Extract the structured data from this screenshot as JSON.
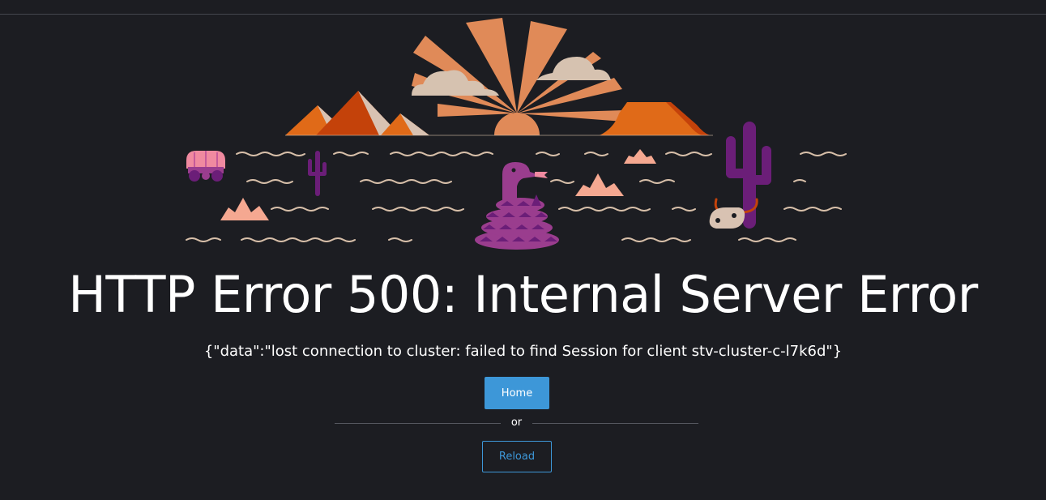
{
  "error": {
    "title": "HTTP Error 500: Internal Server Error",
    "detail": "{\"data\":\"lost connection to cluster: failed to find Session for client stv-cluster-c-l7k6d\"}"
  },
  "actions": {
    "home_label": "Home",
    "separator": "or",
    "reload_label": "Reload"
  },
  "colors": {
    "background": "#1c1d22",
    "primary": "#3d97d8",
    "sun": "#e08a58",
    "mountain_dark": "#c4420a",
    "mountain_orange": "#e06a18",
    "mountain_light": "#d8c2b2",
    "cloud": "#d6c2b0",
    "cactus": "#6b1e78",
    "snake": "#9a3d8e",
    "shrub": "#f5a891",
    "wave": "#d7bfa9"
  },
  "illustration": {
    "icons": [
      "sun-icon",
      "cloud-icon",
      "pyramid-icon",
      "mesa-icon",
      "wagon-icon",
      "cactus-icon",
      "snake-icon",
      "shrub-icon",
      "cow-skull-icon"
    ]
  }
}
